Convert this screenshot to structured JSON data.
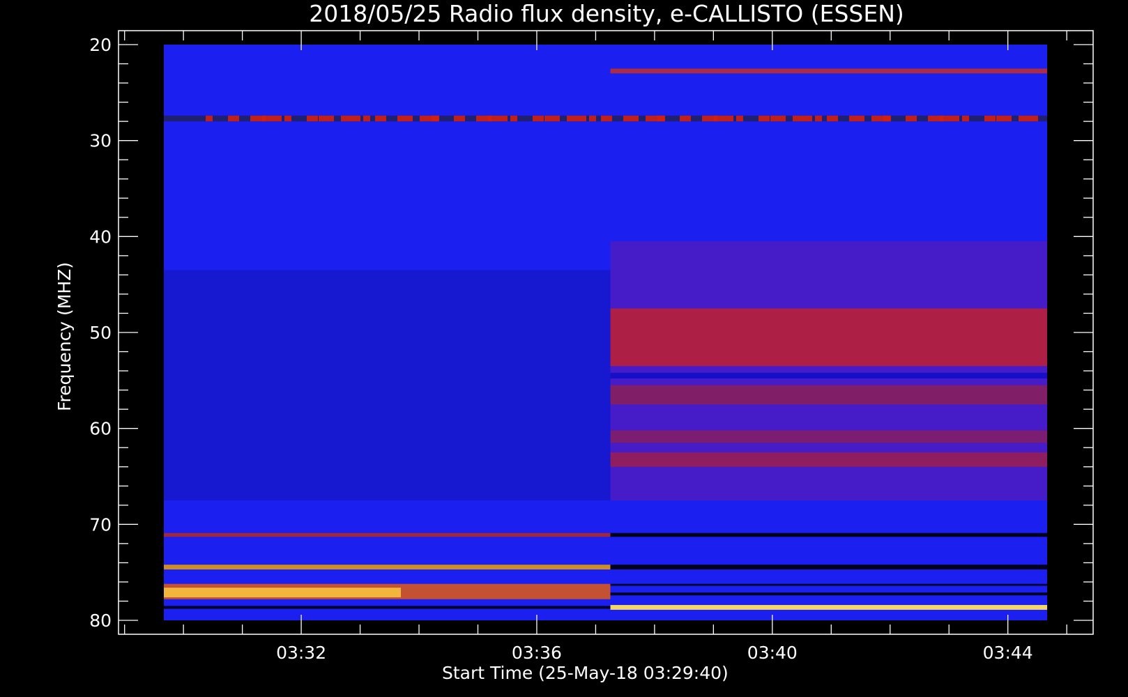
{
  "chart_data": {
    "type": "heatmap",
    "title": "2018/05/25  Radio flux density, e-CALLISTO (ESSEN)",
    "xlabel": "Start Time (25-May-18 03:29:40)",
    "ylabel": "Frequency (MHZ)",
    "x_ticks": [
      "03:32",
      "03:36",
      "03:40",
      "03:44"
    ],
    "y_ticks": [
      "20",
      "30",
      "40",
      "50",
      "60",
      "70",
      "80"
    ],
    "y_range_mhz": [
      20,
      80
    ],
    "y_axis_inverted": true,
    "x_range": [
      "03:29:40",
      "03:44:40"
    ],
    "colormap": [
      "#000000",
      "#0000ff",
      "#ff0000",
      "#ffff00"
    ],
    "colors": {
      "background": "#000000",
      "axes": "#ffffff",
      "text": "#ffffff"
    }
  }
}
